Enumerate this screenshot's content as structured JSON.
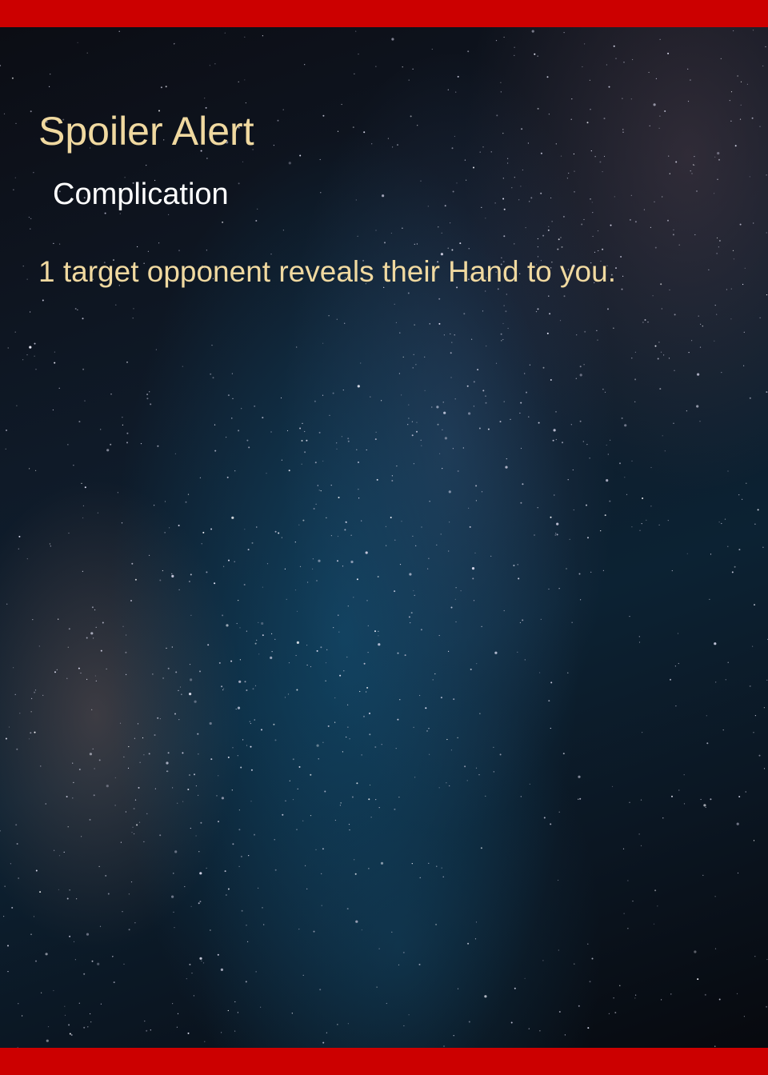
{
  "card": {
    "title": "Spoiler Alert",
    "type": "Complication",
    "rules_text": "1 target opponent reveals their Hand to you.",
    "colors": {
      "border_bar": "#cc0000",
      "title_text": "#f0d9a0",
      "type_text": "#ffffff",
      "rules_text": "#f0d9a0"
    },
    "art": "starry-night-sky-milky-way"
  }
}
